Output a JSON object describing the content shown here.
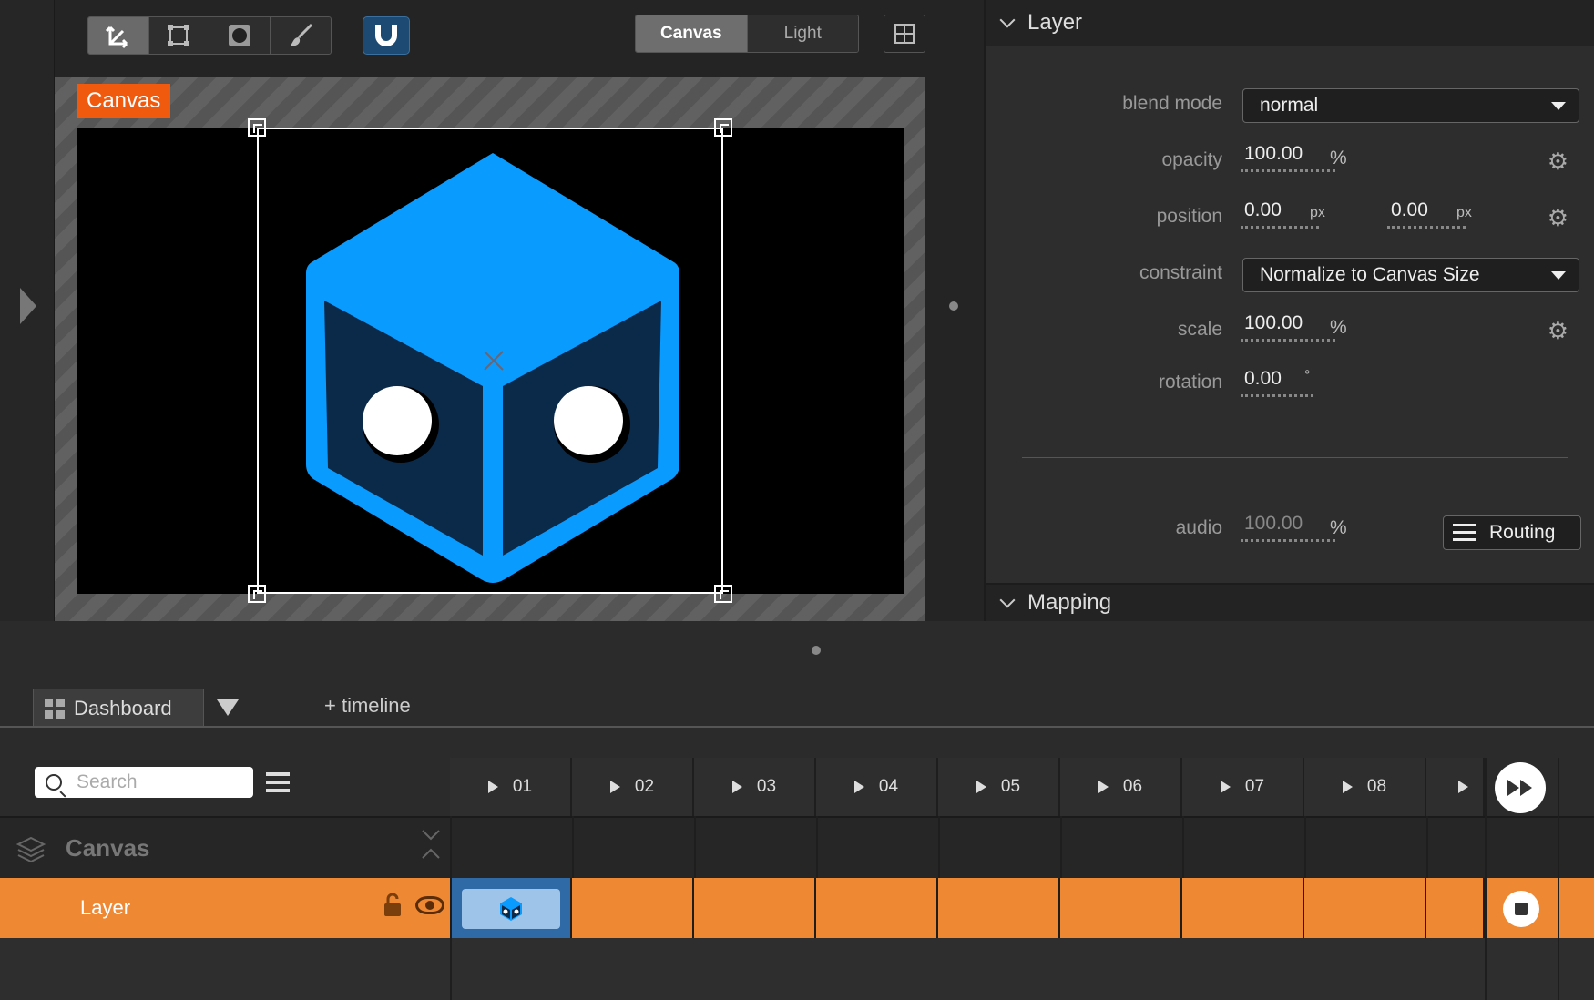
{
  "preview": {
    "tools": [
      "move-tool",
      "transform-tool",
      "mask-tool",
      "brush-tool"
    ],
    "view_modes": [
      "Canvas",
      "Light"
    ],
    "canvas_tag": "Canvas"
  },
  "inspector": {
    "layer_section": "Layer",
    "mapping_section": "Mapping",
    "blend_mode": {
      "label": "blend mode",
      "value": "normal"
    },
    "opacity": {
      "label": "opacity",
      "value": "100.00",
      "unit": "%"
    },
    "position": {
      "label": "position",
      "x": "0.00",
      "y": "0.00",
      "unit": "px"
    },
    "constraint": {
      "label": "constraint",
      "value": "Normalize to Canvas Size"
    },
    "scale": {
      "label": "scale",
      "value": "100.00",
      "unit": "%"
    },
    "rotation": {
      "label": "rotation",
      "value": "0.00",
      "unit": "°"
    },
    "audio": {
      "label": "audio",
      "value": "100.00",
      "unit": "%"
    },
    "routing_label": "Routing"
  },
  "bottom": {
    "dashboard_tab": "Dashboard",
    "add_timeline": "+ timeline",
    "search_placeholder": "Search",
    "columns": [
      "01",
      "02",
      "03",
      "04",
      "05",
      "06",
      "07",
      "08",
      ""
    ],
    "group_name": "Canvas",
    "layer_name": "Layer"
  },
  "colors": {
    "accent_orange": "#ef8833",
    "canvas_tag": "#f05a0f",
    "logo_blue": "#0a9bff",
    "logo_dark": "#0b2a4a",
    "snap_blue": "#1d4a72"
  }
}
